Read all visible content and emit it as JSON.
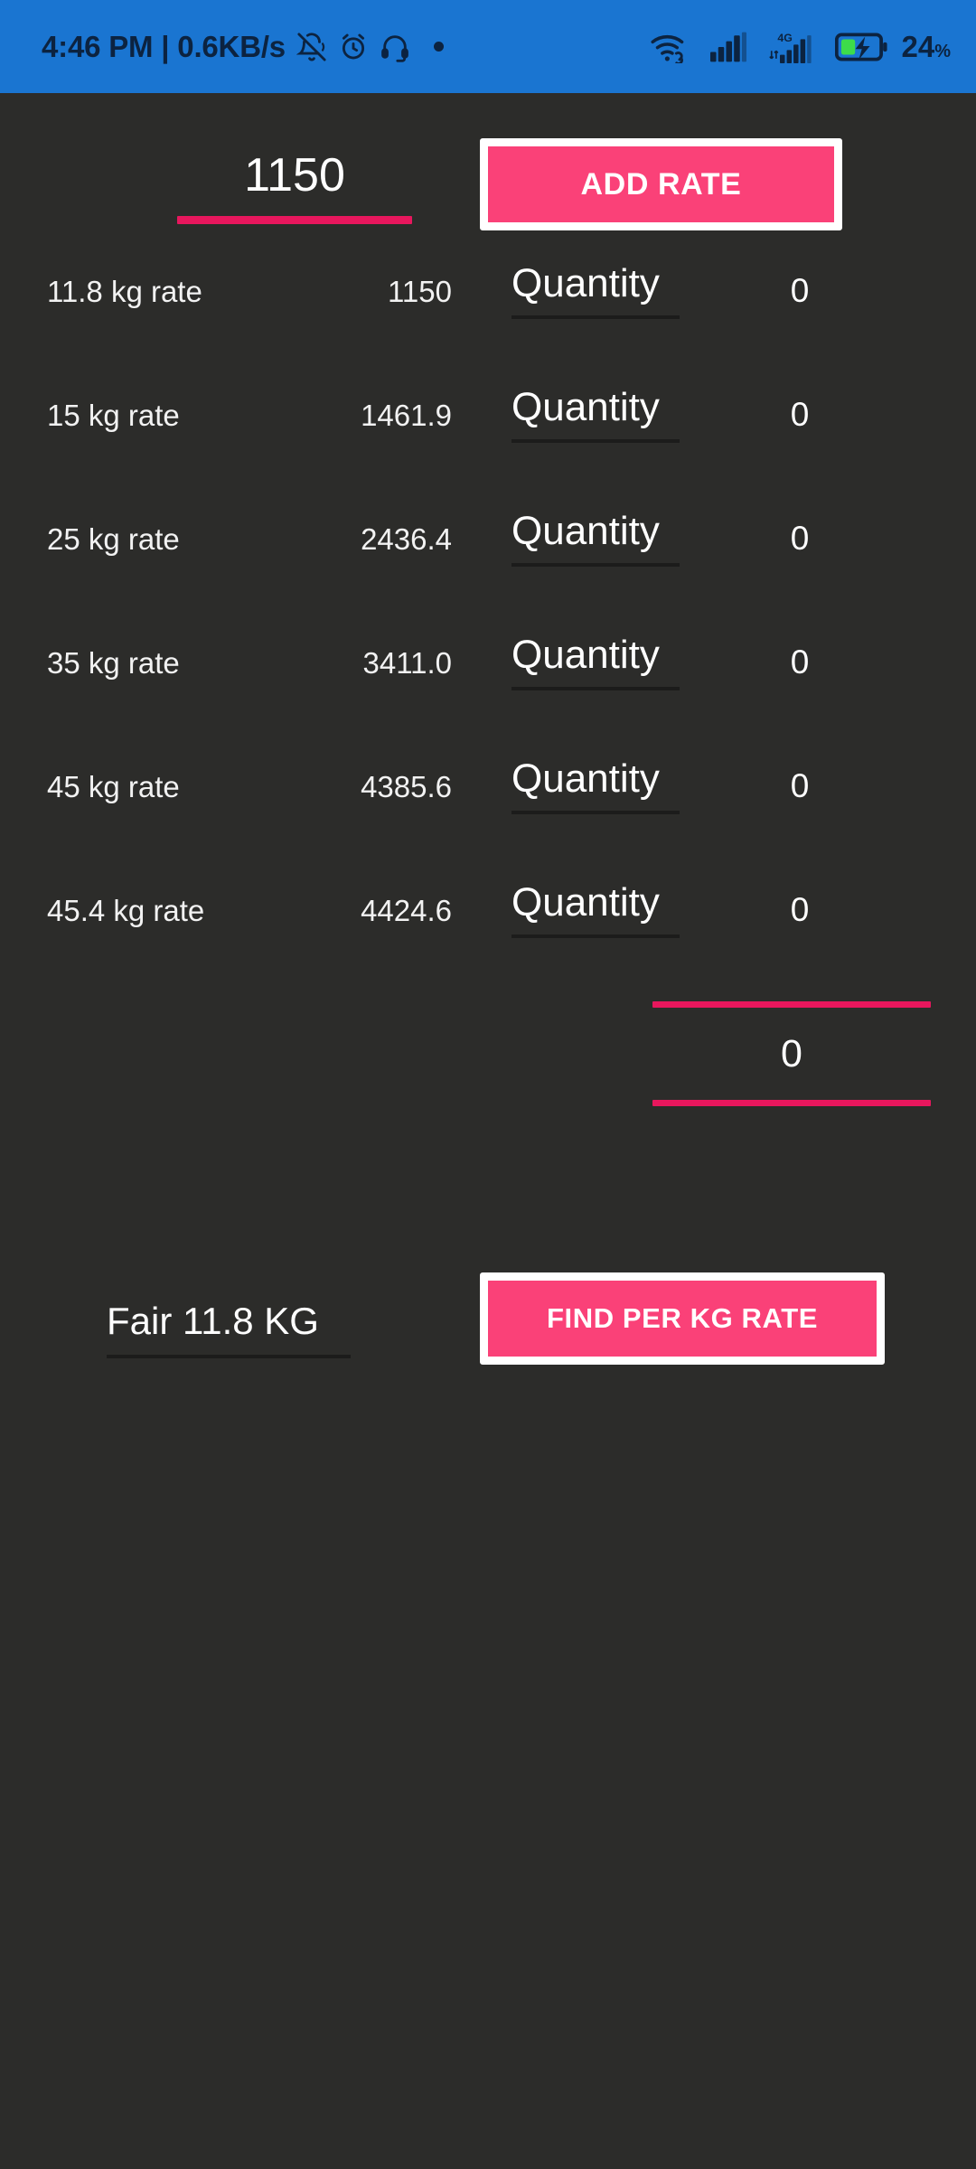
{
  "statusbar": {
    "clock": "4:46 PM | 0.6KB/s",
    "battery_percent": "24",
    "percent_symbol": "%",
    "network_label": "4G",
    "icons_left": [
      "bell-off-icon",
      "alarm-clock-icon",
      "headset-icon",
      "dot-icon"
    ],
    "icons_right": [
      "wifi-link-icon",
      "signal-bars-icon",
      "signal-4g-icon",
      "battery-charging-icon"
    ],
    "background_color": "#1a75d1",
    "icon_color": "#0c2340"
  },
  "theme": {
    "background": "#2c2c2a",
    "accent_pink": "#fa4178",
    "underline_pink": "#e8175d",
    "text": "#ffffff"
  },
  "top": {
    "rate_input_value": "1150",
    "add_rate_label": "ADD RATE"
  },
  "table": {
    "quantity_placeholder": "Quantity",
    "rows": [
      {
        "label": "11.8 kg rate",
        "rate": "1150",
        "quantity": "Quantity",
        "total": "0"
      },
      {
        "label": "15 kg rate",
        "rate": "1461.9",
        "quantity": "Quantity",
        "total": "0"
      },
      {
        "label": "25 kg rate",
        "rate": "2436.4",
        "quantity": "Quantity",
        "total": "0"
      },
      {
        "label": "35 kg rate",
        "rate": "3411.0",
        "quantity": "Quantity",
        "total": "0"
      },
      {
        "label": "45 kg rate",
        "rate": "4385.6",
        "quantity": "Quantity",
        "total": "0"
      },
      {
        "label": "45.4 kg rate",
        "rate": "4424.6",
        "quantity": "Quantity",
        "total": "0"
      }
    ]
  },
  "grand_total": {
    "value": "0"
  },
  "bottom": {
    "fair_value": "Fair 11.8 KG",
    "find_label": "FIND PER KG RATE"
  }
}
